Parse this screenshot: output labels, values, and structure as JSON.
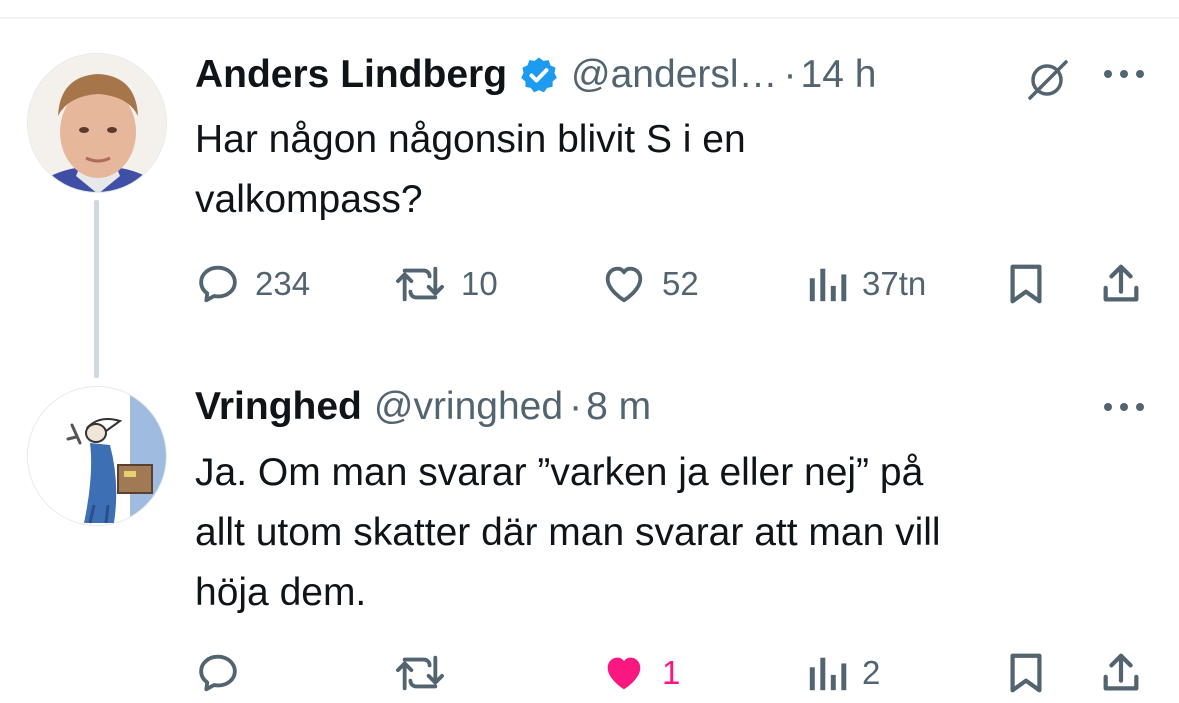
{
  "tweets": [
    {
      "author": "Anders Lindberg",
      "handle": "@andersl…",
      "separator": "·",
      "time": "14 h",
      "text_lines": [
        "Har någon någonsin blivit S i en",
        "valkompass?"
      ],
      "verified": true,
      "stats": {
        "replies": "234",
        "retweets": "10",
        "likes": "52",
        "views": "37tn"
      },
      "icons": [
        "reply-icon",
        "retweet-icon",
        "like-icon",
        "views-icon",
        "bookmark-icon",
        "share-icon",
        "grok-icon",
        "more-icon",
        "verified-badge-icon"
      ]
    },
    {
      "author": "Vringhed",
      "handle": "@vringhed",
      "separator": "·",
      "time": "8 m",
      "text_lines": [
        "Ja. Om man svarar ”varken ja eller nej” på",
        "allt utom skatter där man svarar att man vill",
        "höja dem."
      ],
      "verified": false,
      "stats": {
        "replies": "",
        "retweets": "",
        "likes": "1",
        "views": "2"
      },
      "liked": true,
      "icons": [
        "reply-icon",
        "retweet-icon",
        "like-icon",
        "views-icon",
        "bookmark-icon",
        "share-icon",
        "more-icon"
      ]
    }
  ],
  "colors": {
    "text_primary": "#0f1419",
    "text_secondary": "#536471",
    "verified_blue": "#1d9bf0",
    "like_pink": "#f91880",
    "thread_line": "#cfd9de"
  }
}
